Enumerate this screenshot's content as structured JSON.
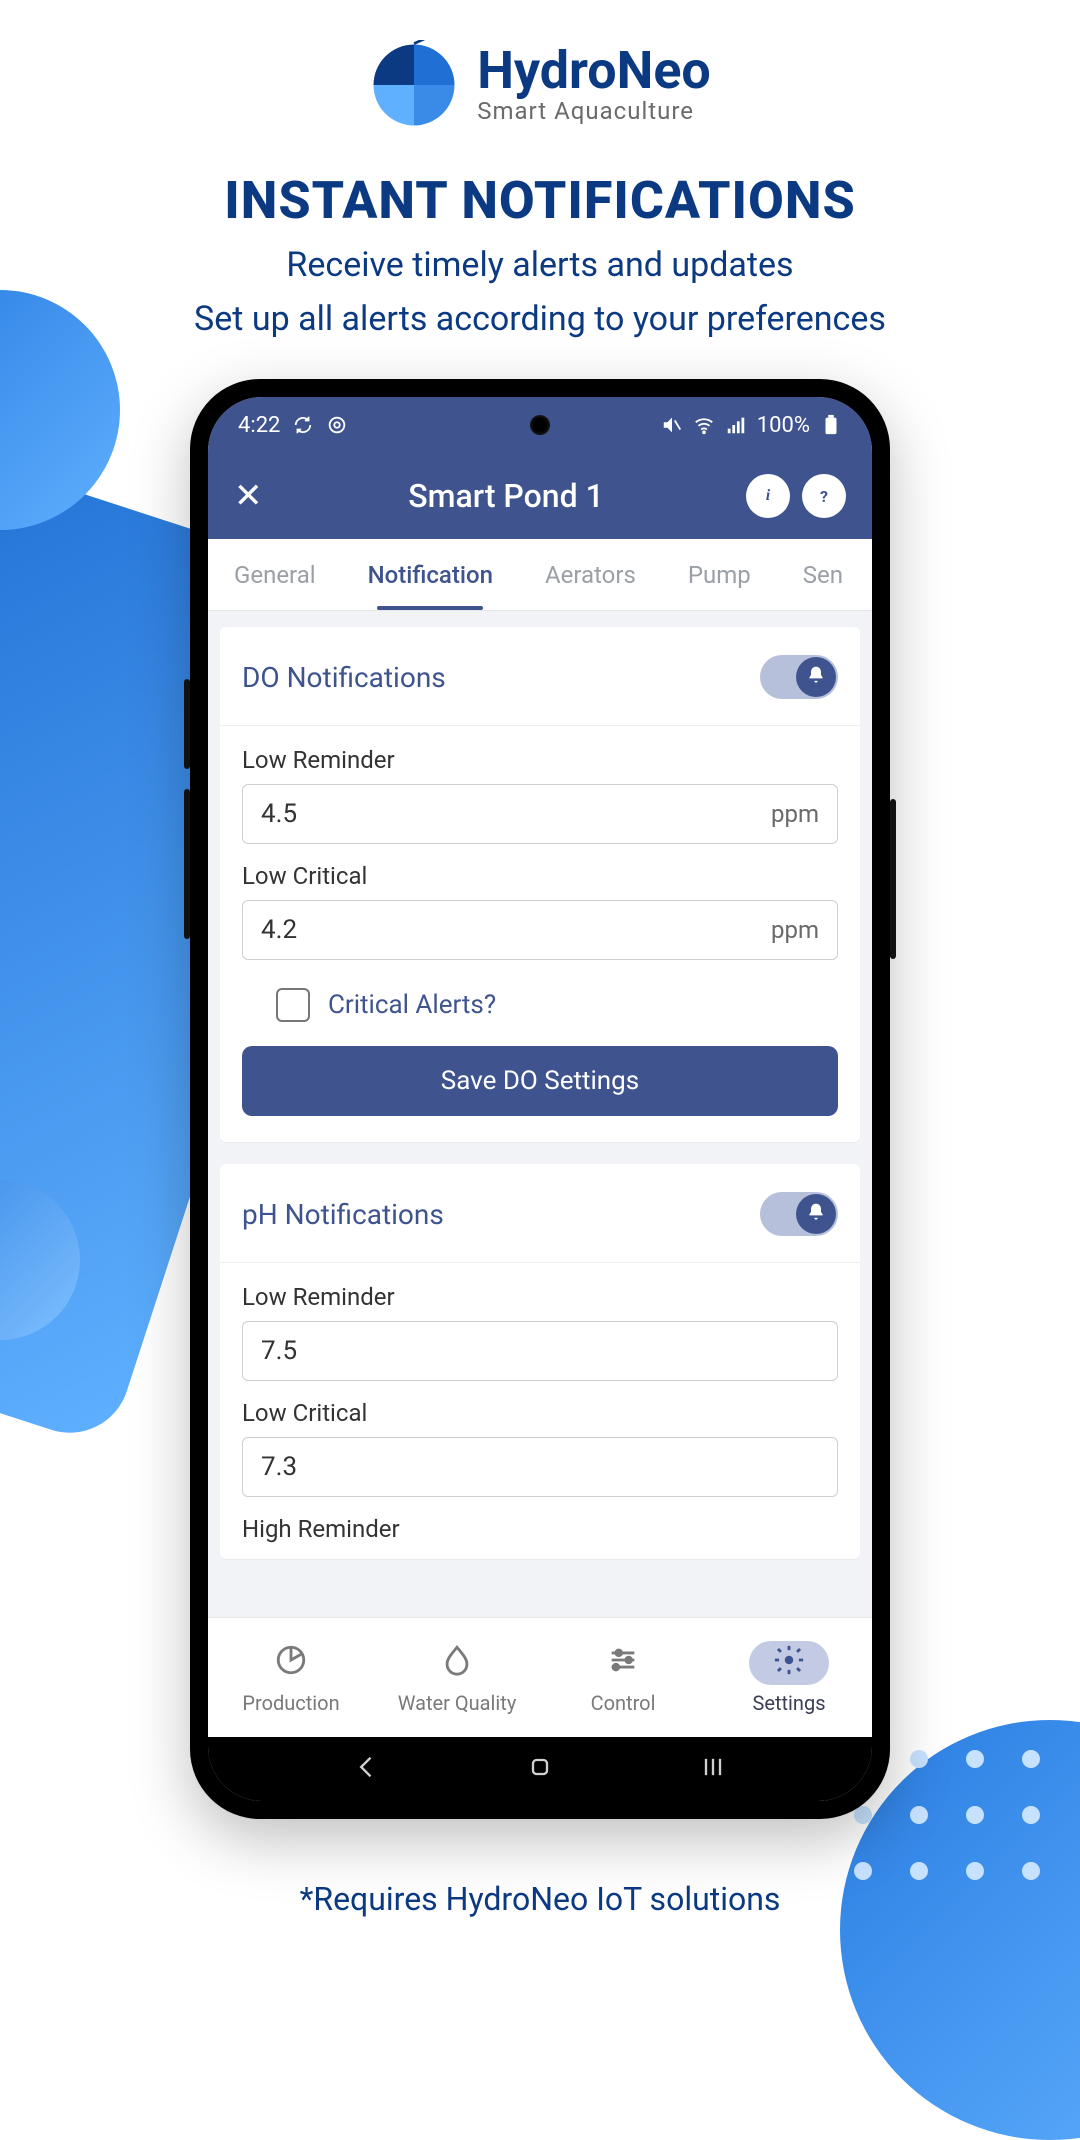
{
  "marketing": {
    "brand": "HydroNeo",
    "tagline": "Smart Aquaculture",
    "headline": "INSTANT NOTIFICATIONS",
    "sub1": "Receive timely alerts and updates",
    "sub2": "Set up all alerts according to your preferences",
    "footnote": "*Requires HydroNeo IoT solutions"
  },
  "statusbar": {
    "time": "4:22",
    "battery_text": "100%"
  },
  "appbar": {
    "title": "Smart Pond 1"
  },
  "tabs": [
    {
      "label": "General",
      "active": false
    },
    {
      "label": "Notification",
      "active": true
    },
    {
      "label": "Aerators",
      "active": false
    },
    {
      "label": "Pump",
      "active": false
    },
    {
      "label": "Sen",
      "active": false
    }
  ],
  "do_card": {
    "title": "DO Notifications",
    "toggle_on": true,
    "low_reminder": {
      "label": "Low Reminder",
      "value": "4.5",
      "unit": "ppm"
    },
    "low_critical": {
      "label": "Low Critical",
      "value": "4.2",
      "unit": "ppm"
    },
    "critical_checkbox_label": "Critical Alerts?",
    "critical_checked": false,
    "save_label": "Save DO Settings"
  },
  "ph_card": {
    "title": "pH Notifications",
    "toggle_on": true,
    "low_reminder": {
      "label": "Low Reminder",
      "value": "7.5"
    },
    "low_critical": {
      "label": "Low Critical",
      "value": "7.3"
    },
    "high_reminder": {
      "label": "High Reminder"
    }
  },
  "bottomnav": [
    {
      "label": "Production",
      "icon": "pie"
    },
    {
      "label": "Water Quality",
      "icon": "drop"
    },
    {
      "label": "Control",
      "icon": "sliders"
    },
    {
      "label": "Settings",
      "icon": "gear",
      "active": true
    }
  ]
}
